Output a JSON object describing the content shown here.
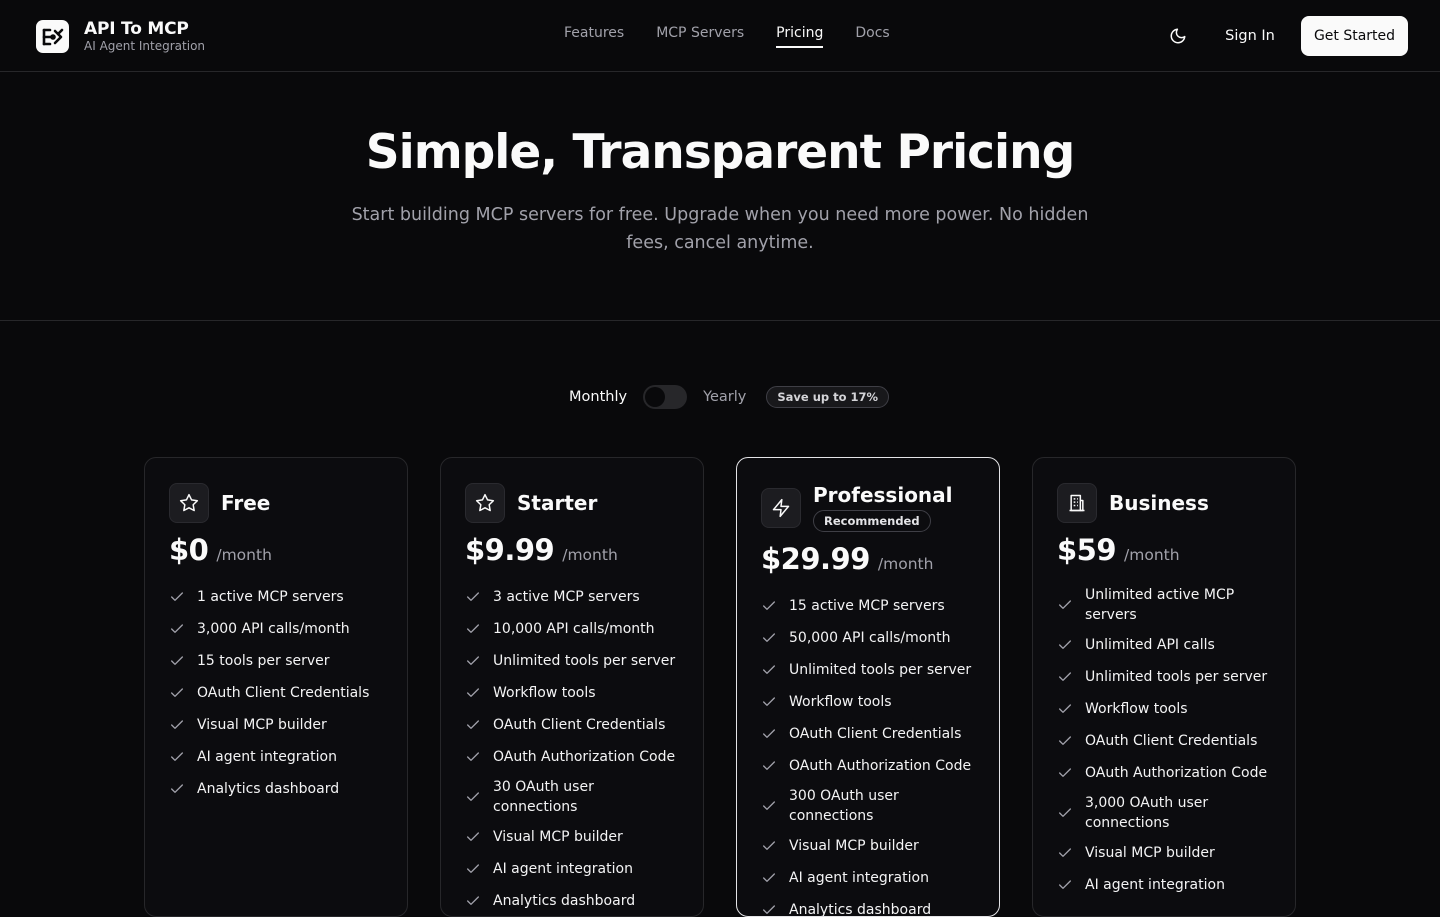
{
  "header": {
    "brand_title": "API To MCP",
    "brand_subtitle": "AI Agent Integration",
    "nav": [
      {
        "label": "Features",
        "active": false
      },
      {
        "label": "MCP Servers",
        "active": false
      },
      {
        "label": "Pricing",
        "active": true
      },
      {
        "label": "Docs",
        "active": false
      }
    ],
    "theme_icon": "moon-icon",
    "sign_in": "Sign In",
    "get_started": "Get Started"
  },
  "hero": {
    "title": "Simple, Transparent Pricing",
    "subtitle": "Start building MCP servers for free. Upgrade when you need more power. No hidden fees, cancel anytime."
  },
  "billing": {
    "monthly_label": "Monthly",
    "yearly_label": "Yearly",
    "yearly_selected": false,
    "save_badge": "Save up to 17%"
  },
  "plans": [
    {
      "name": "Free",
      "icon": "star-icon",
      "price": "$0",
      "period": "/month",
      "badge": "",
      "features": [
        "1 active MCP servers",
        "3,000 API calls/month",
        "15 tools per server",
        "OAuth Client Credentials",
        "Visual MCP builder",
        "AI agent integration",
        "Analytics dashboard"
      ]
    },
    {
      "name": "Starter",
      "icon": "star-icon",
      "price": "$9.99",
      "period": "/month",
      "badge": "",
      "features": [
        "3 active MCP servers",
        "10,000 API calls/month",
        "Unlimited tools per server",
        "Workflow tools",
        "OAuth Client Credentials",
        "OAuth Authorization Code",
        "30 OAuth user connections",
        "Visual MCP builder",
        "AI agent integration",
        "Analytics dashboard"
      ]
    },
    {
      "name": "Professional",
      "icon": "lightning-icon",
      "price": "$29.99",
      "period": "/month",
      "badge": "Recommended",
      "features": [
        "15 active MCP servers",
        "50,000 API calls/month",
        "Unlimited tools per server",
        "Workflow tools",
        "OAuth Client Credentials",
        "OAuth Authorization Code",
        "300 OAuth user connections",
        "Visual MCP builder",
        "AI agent integration",
        "Analytics dashboard"
      ]
    },
    {
      "name": "Business",
      "icon": "building-icon",
      "price": "$59",
      "period": "/month",
      "badge": "",
      "features": [
        "Unlimited active MCP servers",
        "Unlimited API calls",
        "Unlimited tools per server",
        "Workflow tools",
        "OAuth Client Credentials",
        "OAuth Authorization Code",
        "3,000 OAuth user connections",
        "Visual MCP builder",
        "AI agent integration"
      ]
    }
  ]
}
